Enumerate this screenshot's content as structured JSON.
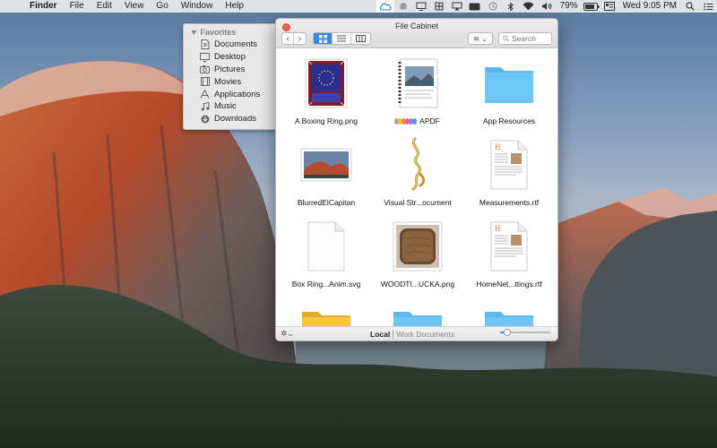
{
  "menubar": {
    "apple_glyph": "",
    "items": [
      "Finder",
      "File",
      "Edit",
      "View",
      "Go",
      "Window",
      "Help"
    ],
    "battery": "79%",
    "clock": "Wed 9:05 PM"
  },
  "favorites": {
    "heading": "▼ Favorites",
    "items": [
      {
        "label": "Documents",
        "icon": "documents-icon"
      },
      {
        "label": "Desktop",
        "icon": "desktop-icon"
      },
      {
        "label": "Pictures",
        "icon": "pictures-icon"
      },
      {
        "label": "Movies",
        "icon": "movies-icon"
      },
      {
        "label": "Applications",
        "icon": "applications-icon"
      },
      {
        "label": "Music",
        "icon": "music-icon"
      },
      {
        "label": "Downloads",
        "icon": "downloads-icon"
      }
    ]
  },
  "window": {
    "title": "File Cabinet",
    "back_glyph": "‹",
    "forward_glyph": "›",
    "search_placeholder": "Search",
    "arrange_glyph": "≋ ⌄",
    "files": [
      {
        "name": "A Boxing Ring.png",
        "icon": "boxing-ring-thumbnail"
      },
      {
        "name": "APDF",
        "icon": "pdf-document-icon",
        "tags": [
          "#a3a3a3",
          "#f2c12e",
          "#f08a3c",
          "#e45f9c",
          "#9b7bdc",
          "#4f95e6"
        ]
      },
      {
        "name": "App Resources",
        "icon": "folder-icon"
      },
      {
        "name": "BlurredElCapitan",
        "icon": "image-thumbnail-icon"
      },
      {
        "name": "Visual Str...ocument",
        "icon": "visual-string-icon"
      },
      {
        "name": "Measurements.rtf",
        "icon": "rtf-document-icon"
      },
      {
        "name": "Box Ring...Anim.svg",
        "icon": "svg-document-icon"
      },
      {
        "name": "WOODTI...UCKA.png",
        "icon": "wood-tile-icon"
      },
      {
        "name": "HomeNet...ttings.rtf",
        "icon": "rtf-document-icon"
      },
      {
        "name": "",
        "icon": "yellow-folder-icon"
      },
      {
        "name": "",
        "icon": "folder-icon"
      },
      {
        "name": "",
        "icon": "folder-icon"
      }
    ],
    "locations": [
      "Local",
      "Work Documents"
    ],
    "active_location": "Local",
    "gear_glyph": "✲⌄",
    "zoom_level": 0.15
  },
  "colors": {
    "accent": "#3a87e8",
    "folder_blue": "#6ec6f5",
    "folder_yellow": "#f5c542",
    "close": "#fc5e57"
  }
}
